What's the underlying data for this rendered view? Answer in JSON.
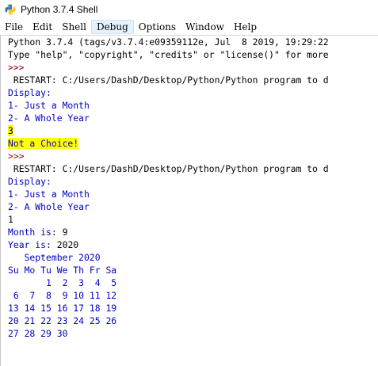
{
  "window": {
    "title": "Python 3.7.4 Shell",
    "icon": "python-icon"
  },
  "menu": [
    "File",
    "Edit",
    "Shell",
    "Debug",
    "Options",
    "Window",
    "Help"
  ],
  "menu_active_index": 3,
  "shell": {
    "lines": [
      {
        "text": "Python 3.7.4 (tags/v3.7.4:e09359112e, Jul  8 2019, 19:29:22",
        "kind": "info"
      },
      {
        "text": "Type \"help\", \"copyright\", \"credits\" or \"license()\" for more",
        "kind": "info"
      },
      {
        "text": ">>> ",
        "kind": "prompt"
      },
      {
        "text": " RESTART: C:/Users/DashD/Desktop/Python/Python program to d",
        "kind": "restart"
      },
      {
        "text": "Display:",
        "kind": "stdout"
      },
      {
        "text": "1- Just a Month",
        "kind": "stdout"
      },
      {
        "text": "2- A Whole Year",
        "kind": "stdout"
      },
      {
        "text": "3",
        "kind": "stdin",
        "highlight": true
      },
      {
        "text": "Not a Choice!",
        "kind": "stdout",
        "highlight": true
      },
      {
        "text": ">>> ",
        "kind": "prompt"
      },
      {
        "text": " RESTART: C:/Users/DashD/Desktop/Python/Python program to d",
        "kind": "restart"
      },
      {
        "text": "Display:",
        "kind": "stdout"
      },
      {
        "text": "1- Just a Month",
        "kind": "stdout"
      },
      {
        "text": "2- A Whole Year",
        "kind": "stdout"
      },
      {
        "text": "1",
        "kind": "stdin"
      },
      {
        "text": "Month is: 9",
        "kind": "mixed",
        "prefix": "Month is: ",
        "value": "9"
      },
      {
        "text": "Year is: 2020",
        "kind": "mixed",
        "prefix": "Year is: ",
        "value": "2020"
      },
      {
        "text": "   September 2020",
        "kind": "stdout"
      },
      {
        "text": "Su Mo Tu We Th Fr Sa",
        "kind": "stdout"
      },
      {
        "text": "       1  2  3  4  5",
        "kind": "stdout"
      },
      {
        "text": " 6  7  8  9 10 11 12",
        "kind": "stdout"
      },
      {
        "text": "13 14 15 16 17 18 19",
        "kind": "stdout"
      },
      {
        "text": "20 21 22 23 24 25 26",
        "kind": "stdout"
      },
      {
        "text": "27 28 29 30",
        "kind": "stdout"
      },
      {
        "text": "",
        "kind": "stdout"
      },
      {
        "text": "",
        "kind": "stdout"
      },
      {
        "text": ">>> ",
        "kind": "prompt"
      }
    ]
  },
  "colors": {
    "stdout": "#0000c0",
    "prompt": "#8b0000",
    "highlight": "#ffff00"
  }
}
